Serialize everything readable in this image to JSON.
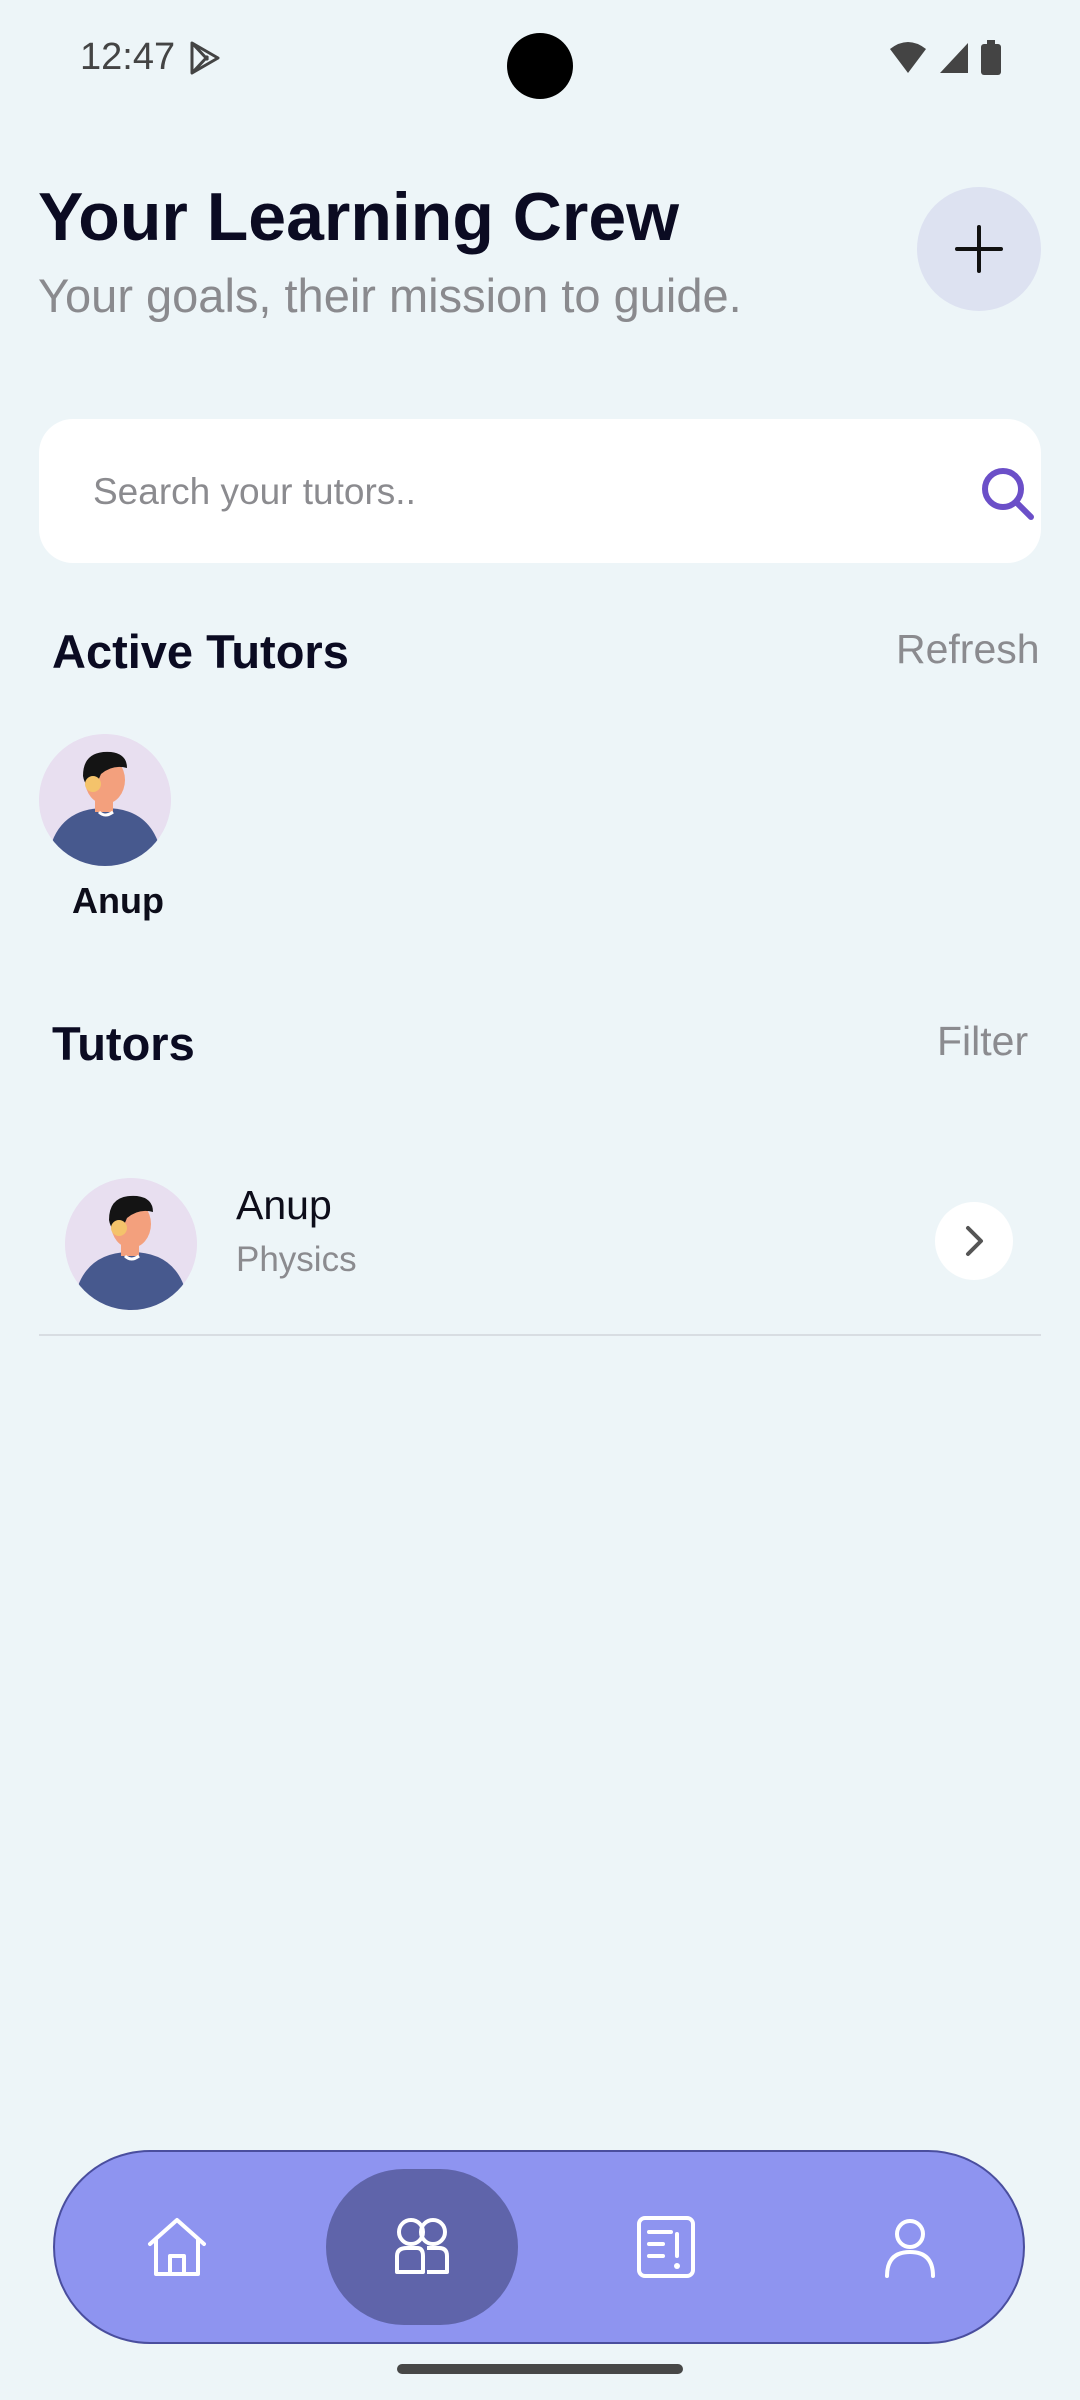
{
  "status_bar": {
    "time": "12:47"
  },
  "header": {
    "title": "Your Learning Crew",
    "subtitle": "Your goals, their mission to guide."
  },
  "search": {
    "placeholder": "Search your tutors.."
  },
  "active_tutors": {
    "title": "Active Tutors",
    "action": "Refresh",
    "items": [
      {
        "name": "Anup"
      }
    ]
  },
  "tutors": {
    "title": "Tutors",
    "action": "Filter",
    "items": [
      {
        "name": "Anup",
        "subject": "Physics"
      }
    ]
  },
  "bottom_nav": {
    "items": [
      {
        "icon": "home-icon",
        "active": false
      },
      {
        "icon": "tutors-icon",
        "active": true
      },
      {
        "icon": "reports-icon",
        "active": false
      },
      {
        "icon": "profile-icon",
        "active": false
      }
    ]
  },
  "colors": {
    "accent": "#6b4fc8",
    "nav_bg": "#8e94f0",
    "nav_active": "#5f64aa",
    "background": "#edf5f8"
  }
}
